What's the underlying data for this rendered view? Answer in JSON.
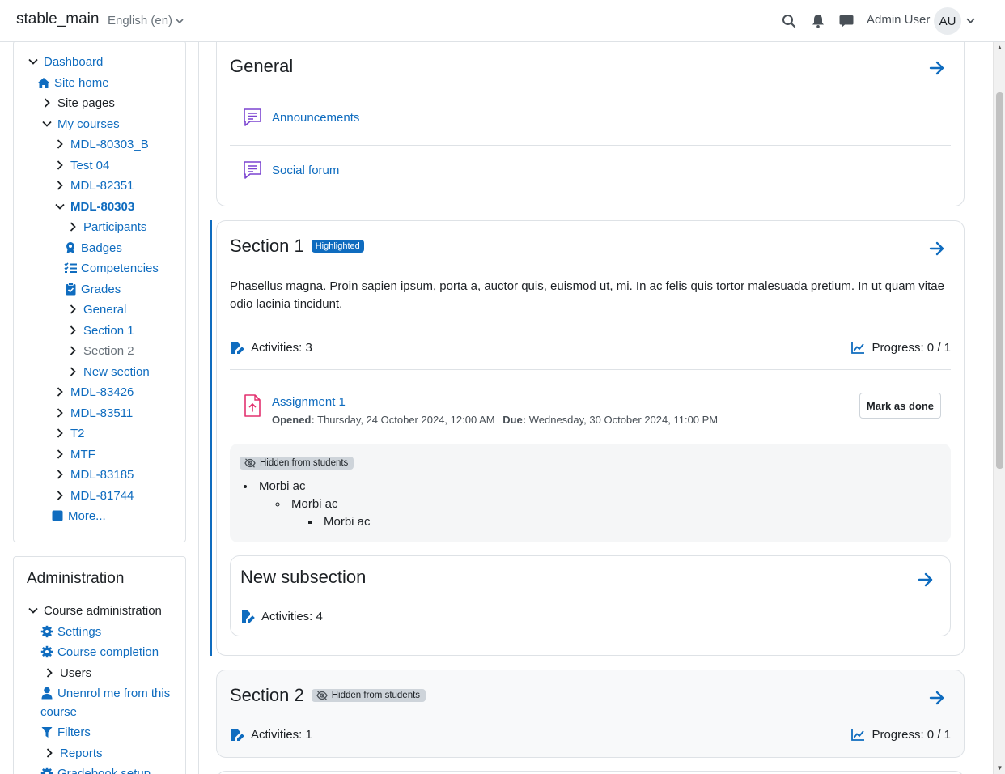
{
  "navbar": {
    "site_name": "stable_main",
    "language": "English (en)",
    "user_name": "Admin User",
    "user_initials": "AU"
  },
  "navigation": {
    "items": [
      {
        "label": "Dashboard"
      },
      {
        "label": "Site home"
      },
      {
        "label": "Site pages"
      },
      {
        "label": "My courses"
      },
      {
        "label": "MDL-80303_B"
      },
      {
        "label": "Test 04"
      },
      {
        "label": "MDL-82351"
      },
      {
        "label": "MDL-80303"
      },
      {
        "label": "Participants"
      },
      {
        "label": "Badges"
      },
      {
        "label": "Competencies"
      },
      {
        "label": "Grades"
      },
      {
        "label": "General"
      },
      {
        "label": "Section 1"
      },
      {
        "label": "Section 2"
      },
      {
        "label": "New section"
      },
      {
        "label": "MDL-83426"
      },
      {
        "label": "MDL-83511"
      },
      {
        "label": "T2"
      },
      {
        "label": "MTF"
      },
      {
        "label": "MDL-83185"
      },
      {
        "label": "MDL-81744"
      },
      {
        "label": "More..."
      }
    ]
  },
  "administration": {
    "title": "Administration",
    "items": [
      {
        "label": "Course administration"
      },
      {
        "label": "Settings"
      },
      {
        "label": "Course completion"
      },
      {
        "label": "Users"
      },
      {
        "label": "Unenrol me from this"
      },
      {
        "label": "course"
      },
      {
        "label": "Filters"
      },
      {
        "label": "Reports"
      },
      {
        "label": "Gradebook setup"
      }
    ]
  },
  "sections": {
    "general": {
      "title": "General",
      "activities": [
        {
          "name": "Announcements",
          "icon": "forum-icon"
        },
        {
          "name": "Social forum",
          "icon": "forum-icon"
        }
      ]
    },
    "section1": {
      "title": "Section 1",
      "badge": "Highlighted",
      "summary_line1": "Phasellus magna. Proin sapien ipsum, porta a, auctor quis, euismod ut, mi. In ac felis quis tortor malesuada pretium. In ut quam vitae",
      "summary_line2": "odio lacinia tincidunt.",
      "activities_count": "Activities: 3",
      "progress": "Progress: 0 / 1",
      "assignment": {
        "name": "Assignment 1",
        "opened_label": "Opened:",
        "opened_value": "Thursday, 24 October 2024, 12:00 AM",
        "due_label": "Due:",
        "due_value": "Wednesday, 30 October 2024, 11:00 PM",
        "button": "Mark as done"
      },
      "hidden_block": {
        "badge": "Hidden from students",
        "list_level1": "Morbi ac",
        "list_level2": "Morbi ac",
        "list_level3": "Morbi ac"
      },
      "subsection": {
        "title": "New subsection",
        "activities_count": "Activities: 4"
      }
    },
    "section2": {
      "title": "Section 2",
      "badge": "Hidden from students",
      "activities_count": "Activities: 1",
      "progress": "Progress: 0 / 1"
    }
  },
  "colors": {
    "link": "#0f6cbf",
    "forum_icon": "#7b44d1",
    "assign_icon": "#e3316f"
  }
}
